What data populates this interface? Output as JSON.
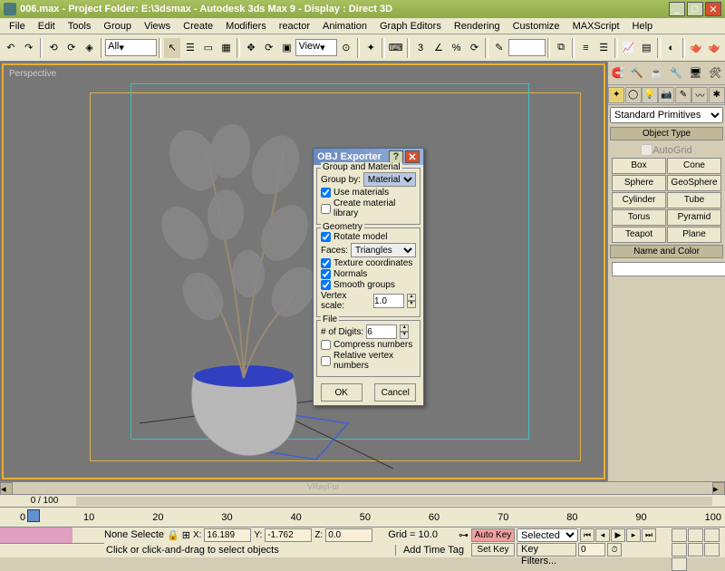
{
  "window": {
    "title": "006.max    - Project Folder: E:\\3dsmax    - Autodesk 3ds Max 9    - Display : Direct 3D"
  },
  "menus": [
    "File",
    "Edit",
    "Tools",
    "Group",
    "Views",
    "Create",
    "Modifiers",
    "reactor",
    "Animation",
    "Graph Editors",
    "Rendering",
    "Customize",
    "MAXScript",
    "Help"
  ],
  "toolbar": {
    "selSet": "All",
    "viewSel": "View"
  },
  "viewport": {
    "label": "Perspective",
    "vrayfur": "VRayFur"
  },
  "panel": {
    "dropdown": "Standard Primitives",
    "rollout_objtype": "Object Type",
    "autogrid": "AutoGrid",
    "buttons": [
      "Box",
      "Cone",
      "Sphere",
      "GeoSphere",
      "Cylinder",
      "Tube",
      "Torus",
      "Pyramid",
      "Teapot",
      "Plane"
    ],
    "rollout_name": "Name and Color"
  },
  "dialog": {
    "title": "OBJ Exporter",
    "grp_mat": "Group and Material",
    "groupby_label": "Group by:",
    "groupby_value": "Material",
    "use_materials": "Use materials",
    "create_lib": "Create material library",
    "geometry": "Geometry",
    "rotate": "Rotate model",
    "faces_label": "Faces:",
    "faces_value": "Triangles",
    "texcoords": "Texture coordinates",
    "normals": "Normals",
    "smooth": "Smooth groups",
    "vscale_label": "Vertex scale:",
    "vscale_value": "1.0",
    "file": "File",
    "digits_label": "# of Digits:",
    "digits_value": "6",
    "compress": "Compress numbers",
    "relative": "Relative vertex numbers",
    "ok": "OK",
    "cancel": "Cancel"
  },
  "slider": {
    "frame": "0 / 100"
  },
  "timeline": {
    "marks": [
      "0",
      "10",
      "20",
      "30",
      "40",
      "50",
      "60",
      "70",
      "80",
      "90",
      "100"
    ]
  },
  "status": {
    "selection": "None Selecte",
    "x": "16.189",
    "y": "-1.762",
    "z": "0.0",
    "grid": "Grid = 10.0",
    "prompt": "Click or click-and-drag to select objects",
    "addtag": "Add Time Tag",
    "autokey": "Auto Key",
    "setkey": "Set Key",
    "keymode": "Selected",
    "keyfilters": "Key Filters..."
  }
}
